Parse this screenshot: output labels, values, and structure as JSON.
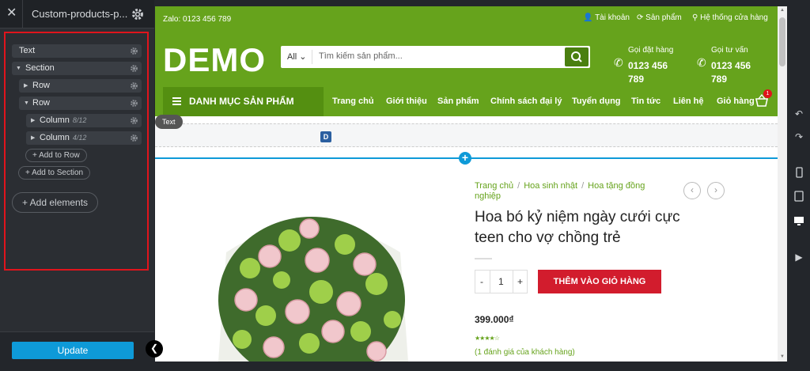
{
  "editor": {
    "page_title": "Custom-products-p...",
    "tree": {
      "text_node": "Text",
      "section_node": "Section",
      "row1": "Row",
      "row2": "Row",
      "column1": {
        "label": "Column",
        "fraction": "8/12"
      },
      "column2": {
        "label": "Column",
        "fraction": "4/12"
      },
      "add_to_row": "+ Add to Row",
      "add_to_section": "+ Add to Section",
      "add_elements": "+ Add elements"
    },
    "update_label": "Update",
    "accent": "#0e9ad8",
    "highlight": "#e0141c"
  },
  "site": {
    "topbar": {
      "zalo": "Zalo: 0123 456 789",
      "account": "Tài khoản",
      "products": "Sản phẩm",
      "stores": "Hệ thống cửa hàng"
    },
    "logo": "DEMO",
    "search": {
      "category": "All",
      "placeholder": "Tìm kiếm sản phẩm..."
    },
    "order_call": {
      "label": "Gọi đặt hàng",
      "phone": "0123 456 789"
    },
    "consult_call": {
      "label": "Gọi tư vấn",
      "phone": "0123 456 789"
    },
    "nav": {
      "category_menu": "DANH MỤC SẢN PHẨM",
      "items": [
        "Trang chủ",
        "Giới thiệu",
        "Sản phẩm",
        "Chính sách đại lý",
        "Tuyển dụng",
        "Tin tức",
        "Liên hệ",
        "Giỏ hàng"
      ],
      "cart_count": "1"
    },
    "element_tag": "Text",
    "block_letter": "D",
    "product": {
      "breadcrumb": [
        "Trang chủ",
        "Hoa sinh nhật",
        "Hoa tặng đồng nghiệp"
      ],
      "title": "Hoa bó kỷ niệm ngày cưới cực teen cho vợ chồng trẻ",
      "quantity": "1",
      "qty_minus": "-",
      "qty_plus": "+",
      "add_to_cart": "THÊM VÀO GIỎ HÀNG",
      "price": "399.000₫",
      "rating": "★★★★☆",
      "review_text": "(1 đánh giá của khách hàng)"
    },
    "brand_green": "#66a31c",
    "cta_red": "#d21c2d"
  }
}
